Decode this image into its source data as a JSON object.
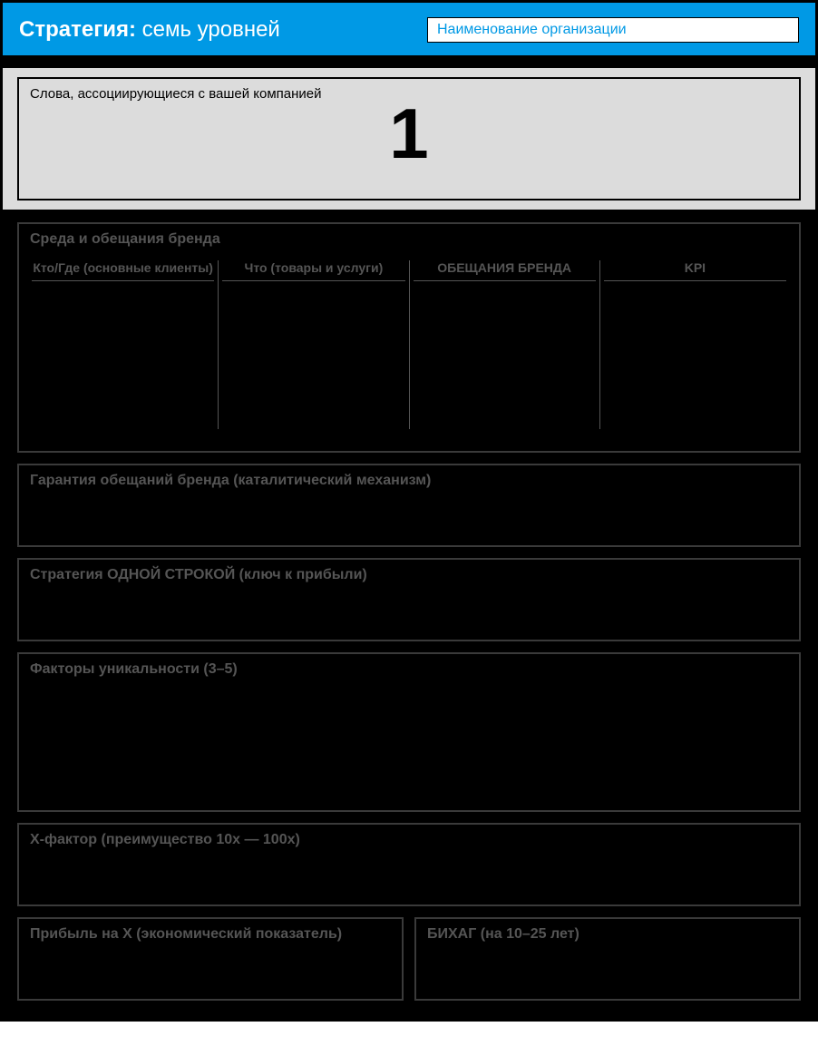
{
  "header": {
    "title_bold": "Стратегия:",
    "title_rest": " семь уровней",
    "org_placeholder": "Наименование организации"
  },
  "words_block": {
    "label": "Слова, ассоциирующиеся с вашей компанией",
    "big_number": "1"
  },
  "panels": {
    "environment": {
      "title": "Среда и обещания бренда",
      "cols": [
        "Кто/Где (основные клиенты)",
        "Что (товары и услуги)",
        "ОБЕЩАНИЯ БРЕНДА",
        "KPI"
      ]
    },
    "guarantee": {
      "title": "Гарантия обещаний бренда (каталитический механизм)"
    },
    "oneline": {
      "title": "Стратегия ОДНОЙ СТРОКОЙ (ключ к прибыли)"
    },
    "unique": {
      "title": "Факторы уникальности (3–5)"
    },
    "xfactor": {
      "title": "Х-фактор (преимущество 10х — 100х)"
    },
    "profit": {
      "title": "Прибыль на Х (экономический показатель)"
    },
    "bhag": {
      "title": "БИХАГ (на 10–25 лет)"
    }
  }
}
